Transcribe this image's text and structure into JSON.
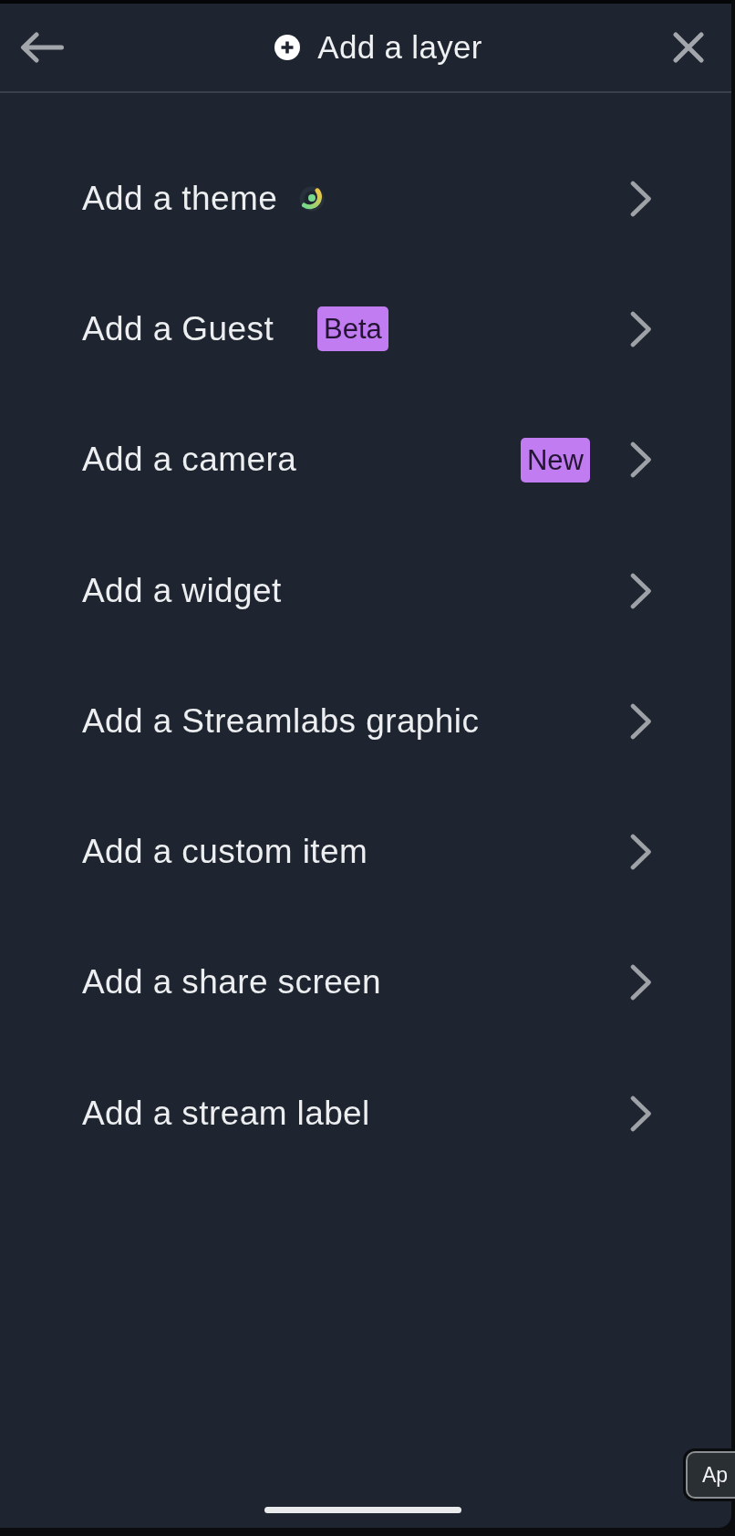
{
  "header": {
    "title": "Add a layer"
  },
  "items": [
    {
      "label": "Add a theme",
      "kind": "with-icon"
    },
    {
      "label": "Add a Guest",
      "kind": "with-badge",
      "badge": "Beta"
    },
    {
      "label": "Add a camera",
      "kind": "with-trailing-badge",
      "badge": "New"
    },
    {
      "label": "Add a widget",
      "kind": "plain"
    },
    {
      "label": "Add a Streamlabs graphic",
      "kind": "plain"
    },
    {
      "label": "Add a custom item",
      "kind": "plain"
    },
    {
      "label": "Add a share screen",
      "kind": "plain"
    },
    {
      "label": "Add a stream label",
      "kind": "plain"
    }
  ],
  "floating_button": {
    "label": "Ap"
  }
}
